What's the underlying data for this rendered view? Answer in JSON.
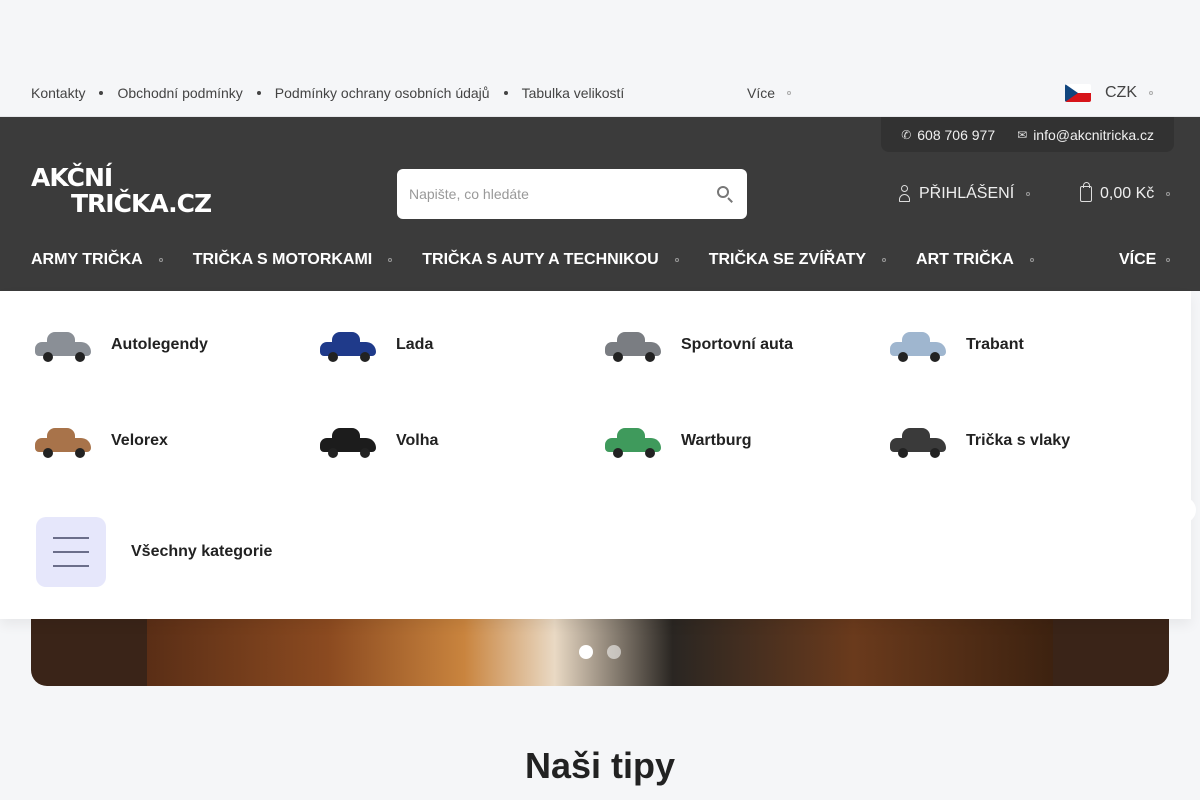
{
  "topbar": {
    "links": [
      "Kontakty",
      "Obchodní podmínky",
      "Podmínky ochrany osobních údajů",
      "Tabulka velikostí"
    ],
    "more_label": "Více",
    "currency": "CZK"
  },
  "header": {
    "phone": "608 706 977",
    "email": "info@akcnitricka.cz",
    "logo_line1": "AKČNÍ",
    "logo_line2": "TRIČKA.CZ",
    "search_placeholder": "Napište, co hledáte",
    "login_label": "Přihlášení",
    "cart_total": "0,00 Kč"
  },
  "nav": {
    "items": [
      "Army trička",
      "Trička s motorkami",
      "Trička s auty a technikou",
      "Trička se zvířaty",
      "Art trička"
    ],
    "more_label": "Více"
  },
  "mega_menu": {
    "categories": [
      {
        "label": "Autolegendy",
        "color": "#8a8f96"
      },
      {
        "label": "Lada",
        "color": "#1f3a8a"
      },
      {
        "label": "Sportovní auta",
        "color": "#7a7d82"
      },
      {
        "label": "Trabant",
        "color": "#9fb6cf"
      },
      {
        "label": "Velorex",
        "color": "#a8734a"
      },
      {
        "label": "Volha",
        "color": "#1c1c1c"
      },
      {
        "label": "Wartburg",
        "color": "#3f9a5c"
      },
      {
        "label": "Trička s vlaky",
        "color": "#3a3a3a"
      }
    ],
    "all_label": "Všechny kategorie"
  },
  "hero": {
    "slide_count": 2,
    "active_slide": 1
  },
  "section": {
    "title": "Naši tipy"
  }
}
